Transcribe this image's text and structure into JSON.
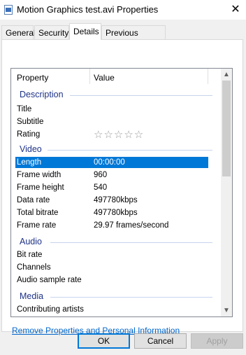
{
  "window": {
    "title": "Motion Graphics test.avi Properties",
    "icon": "document-video-icon",
    "close_glyph": "✕"
  },
  "tabs": [
    {
      "label": "General",
      "active": false
    },
    {
      "label": "Security",
      "active": false
    },
    {
      "label": "Details",
      "active": true
    },
    {
      "label": "Previous Versions",
      "active": false
    }
  ],
  "list": {
    "columns": {
      "property": "Property",
      "value": "Value"
    },
    "groups": {
      "description": "Description",
      "video": "Video",
      "audio": "Audio",
      "media": "Media"
    },
    "rows": {
      "title": {
        "property": "Title",
        "value": ""
      },
      "subtitle": {
        "property": "Subtitle",
        "value": ""
      },
      "rating": {
        "property": "Rating",
        "stars": 0,
        "max_stars": 5,
        "star_glyphs": "☆☆☆☆☆"
      },
      "length": {
        "property": "Length",
        "value": "00:00:00",
        "selected": true
      },
      "frame_width": {
        "property": "Frame width",
        "value": "960"
      },
      "frame_height": {
        "property": "Frame height",
        "value": "540"
      },
      "data_rate": {
        "property": "Data rate",
        "value": "497780kbps"
      },
      "total_bitrate": {
        "property": "Total bitrate",
        "value": "497780kbps"
      },
      "frame_rate": {
        "property": "Frame rate",
        "value": "29.97 frames/second"
      },
      "bit_rate": {
        "property": "Bit rate",
        "value": ""
      },
      "channels": {
        "property": "Channels",
        "value": ""
      },
      "audio_sample_rate": {
        "property": "Audio sample rate",
        "value": ""
      },
      "contributing_artists": {
        "property": "Contributing artists",
        "value": ""
      }
    }
  },
  "remove_link": "Remove Properties and Personal Information",
  "buttons": {
    "ok": "OK",
    "cancel": "Cancel",
    "apply": "Apply"
  },
  "colors": {
    "selection": "#0078d7",
    "group_header": "#1e3287",
    "link": "#0066cc"
  }
}
